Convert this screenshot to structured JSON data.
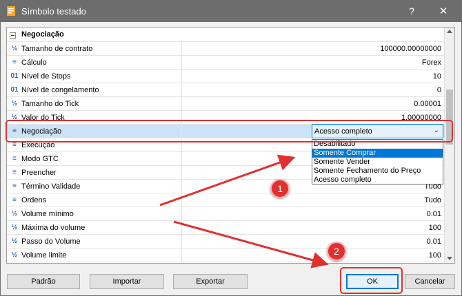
{
  "window": {
    "title": "Símbolo testado",
    "help_label": "?",
    "close_label": "✕"
  },
  "grid": {
    "section_title": "Negociação",
    "rows": [
      {
        "icon": "½",
        "icon_name": "fraction-icon",
        "name": "Tamanho de contrato",
        "value": "100000.00000000"
      },
      {
        "icon": "≡",
        "icon_name": "list-icon",
        "name": "Cálculo",
        "value": "Forex"
      },
      {
        "icon": "01",
        "icon_name": "integer-icon",
        "name": "Nível de Stops",
        "value": "10"
      },
      {
        "icon": "01",
        "icon_name": "integer-icon",
        "name": "Nível de congelamento",
        "value": "0"
      },
      {
        "icon": "½",
        "icon_name": "fraction-icon",
        "name": "Tamanho do Tick",
        "value": "0.00001"
      },
      {
        "icon": "½",
        "icon_name": "fraction-icon",
        "name": "Valor do Tick",
        "value": "1.00000000"
      },
      {
        "icon": "≡",
        "icon_name": "list-icon",
        "name": "Negociação",
        "value": ""
      },
      {
        "icon": "≡",
        "icon_name": "list-icon",
        "name": "Execução",
        "value": ""
      },
      {
        "icon": "≡",
        "icon_name": "list-icon",
        "name": "Modo GTC",
        "value": ""
      },
      {
        "icon": "≡",
        "icon_name": "list-icon",
        "name": "Preencher",
        "value": ""
      },
      {
        "icon": "≡",
        "icon_name": "list-icon",
        "name": "Término Validade",
        "value": "Tudo"
      },
      {
        "icon": "≡",
        "icon_name": "list-icon",
        "name": "Ordens",
        "value": "Tudo"
      },
      {
        "icon": "½",
        "icon_name": "fraction-icon",
        "name": "Volume mínimo",
        "value": "0.01"
      },
      {
        "icon": "½",
        "icon_name": "fraction-icon",
        "name": "Máxima do volume",
        "value": "100"
      },
      {
        "icon": "½",
        "icon_name": "fraction-icon",
        "name": "Passo do Volume",
        "value": "0.01"
      },
      {
        "icon": "½",
        "icon_name": "fraction-icon",
        "name": "Volume limite",
        "value": "100"
      }
    ]
  },
  "combo": {
    "selected": "Acesso completo",
    "options": [
      "Desabilitado",
      "Somente Comprar",
      "Somente Vender",
      "Somente Fechamento do Preço",
      "Acesso completo"
    ],
    "highlighted_option": "Somente Comprar"
  },
  "buttons": {
    "default": "Padrão",
    "import": "Importar",
    "export": "Exportar",
    "ok": "OK",
    "cancel": "Cancelar"
  },
  "annotations": {
    "badge1": "1",
    "badge2": "2"
  },
  "colors": {
    "titlebar": "#6d6d6d",
    "accent": "#0078d7",
    "highlight": "#e03030",
    "selected_row": "#cce3f7"
  }
}
